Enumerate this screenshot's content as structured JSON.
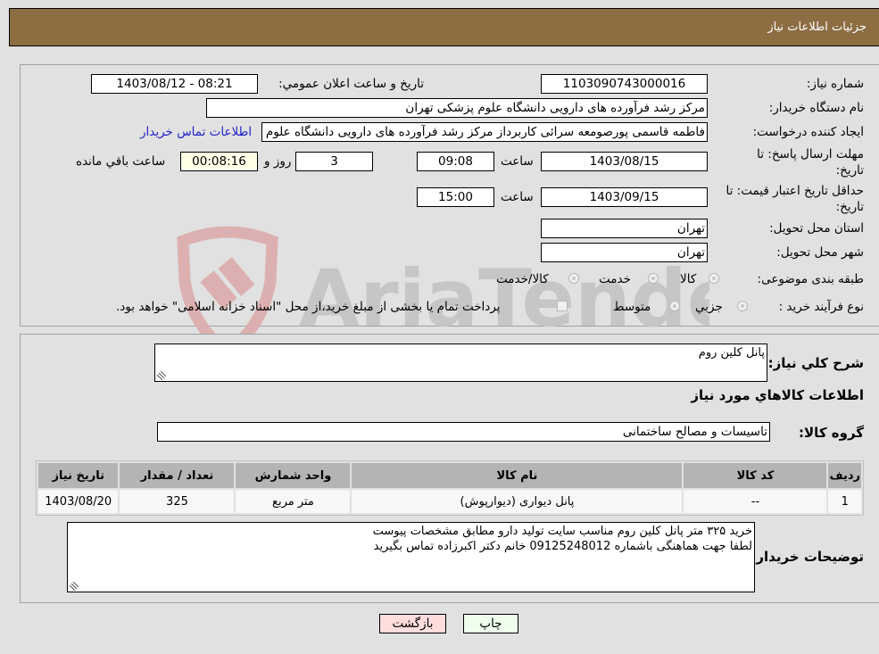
{
  "header": {
    "title": "جزئیات اطلاعات نیاز"
  },
  "form": {
    "need_number": {
      "label": "شماره نیاز:",
      "value": "1103090743000016"
    },
    "announce_datetime": {
      "label": "تاريخ و ساعت اعلان عمومي:",
      "value": "1403/08/12 - 08:21"
    },
    "buyer_org": {
      "label": "نام دستگاه خريدار:",
      "value": "مرکز رشد فرآورده های دارویی دانشگاه علوم پزشکی تهران"
    },
    "requester": {
      "label": "ايجاد کننده درخواست:",
      "value": "فاطمه قاسمی پورصومعه سرائی کاربرداز مرکز رشد فرآورده های دارویی دانشگاه علوم پزشکی تهران",
      "contact_link": "اطلاعات تماس خريدار"
    },
    "reply_deadline": {
      "label": "مهلت ارسال پاسخ: تا تاريخ:",
      "date": "1403/08/15",
      "time_label": "ساعت",
      "time": "09:08",
      "days": "3",
      "days_label": "روز و",
      "remaining": "00:08:16",
      "remaining_label": "ساعت باقي مانده"
    },
    "price_validity": {
      "label": "حداقل تاريخ اعتبار قيمت: تا تاريخ:",
      "date": "1403/09/15",
      "time_label": "ساعت",
      "time": "15:00"
    },
    "delivery_province": {
      "label": "استان محل تحويل:",
      "value": "تهران"
    },
    "delivery_city": {
      "label": "شهر محل تحويل:",
      "value": "تهران"
    },
    "category": {
      "label": "طبقه بندی موضوعی:",
      "options": [
        "کالا",
        "خدمت",
        "کالا/خدمت"
      ]
    },
    "process_type": {
      "label": "نوع فرآيند خريد :",
      "options": [
        "جزيي",
        "متوسط"
      ],
      "treasury_note": "پرداخت تمام يا بخشی از مبلغ خريد،از محل \"اسناد خزانه اسلامی\" خواهد بود."
    }
  },
  "details": {
    "general_desc": {
      "label": "شرح کلي نياز:",
      "value": "پانل کلین روم"
    },
    "items_heading": "اطلاعات کالاهاي مورد نياز",
    "goods_group": {
      "label": "گروه کالا:",
      "value": "تاسیسات و مصالح ساختمانی"
    },
    "table": {
      "headers": [
        "رديف",
        "کد کالا",
        "نام کالا",
        "واحد شمارش",
        "تعداد / مقدار",
        "تاریخ نیاز"
      ],
      "rows": [
        [
          "1",
          "--",
          "پانل دیواری (دیوارپوش)",
          "متر مربع",
          "325",
          "1403/08/20"
        ]
      ]
    },
    "buyer_notes": {
      "label": "توضيحات خريدار:",
      "lines": [
        "خرید ۳۲۵ متر پانل کلین روم  مناسب سایت تولید دارو مطابق مشخصات پیوست",
        "لطفا جهت هماهنگی باشماره  09125248012 خانم دکتر اکبرزاده تماس بگیرید"
      ]
    }
  },
  "buttons": {
    "print": "چاپ",
    "back": "بازگشت"
  },
  "watermark": {
    "text": "AriaTender.neT"
  },
  "colors": {
    "header_bg": "#8d6e43",
    "print_bg": "#eeffee",
    "back_bg": "#ffdddd",
    "link": "#2222cc"
  }
}
